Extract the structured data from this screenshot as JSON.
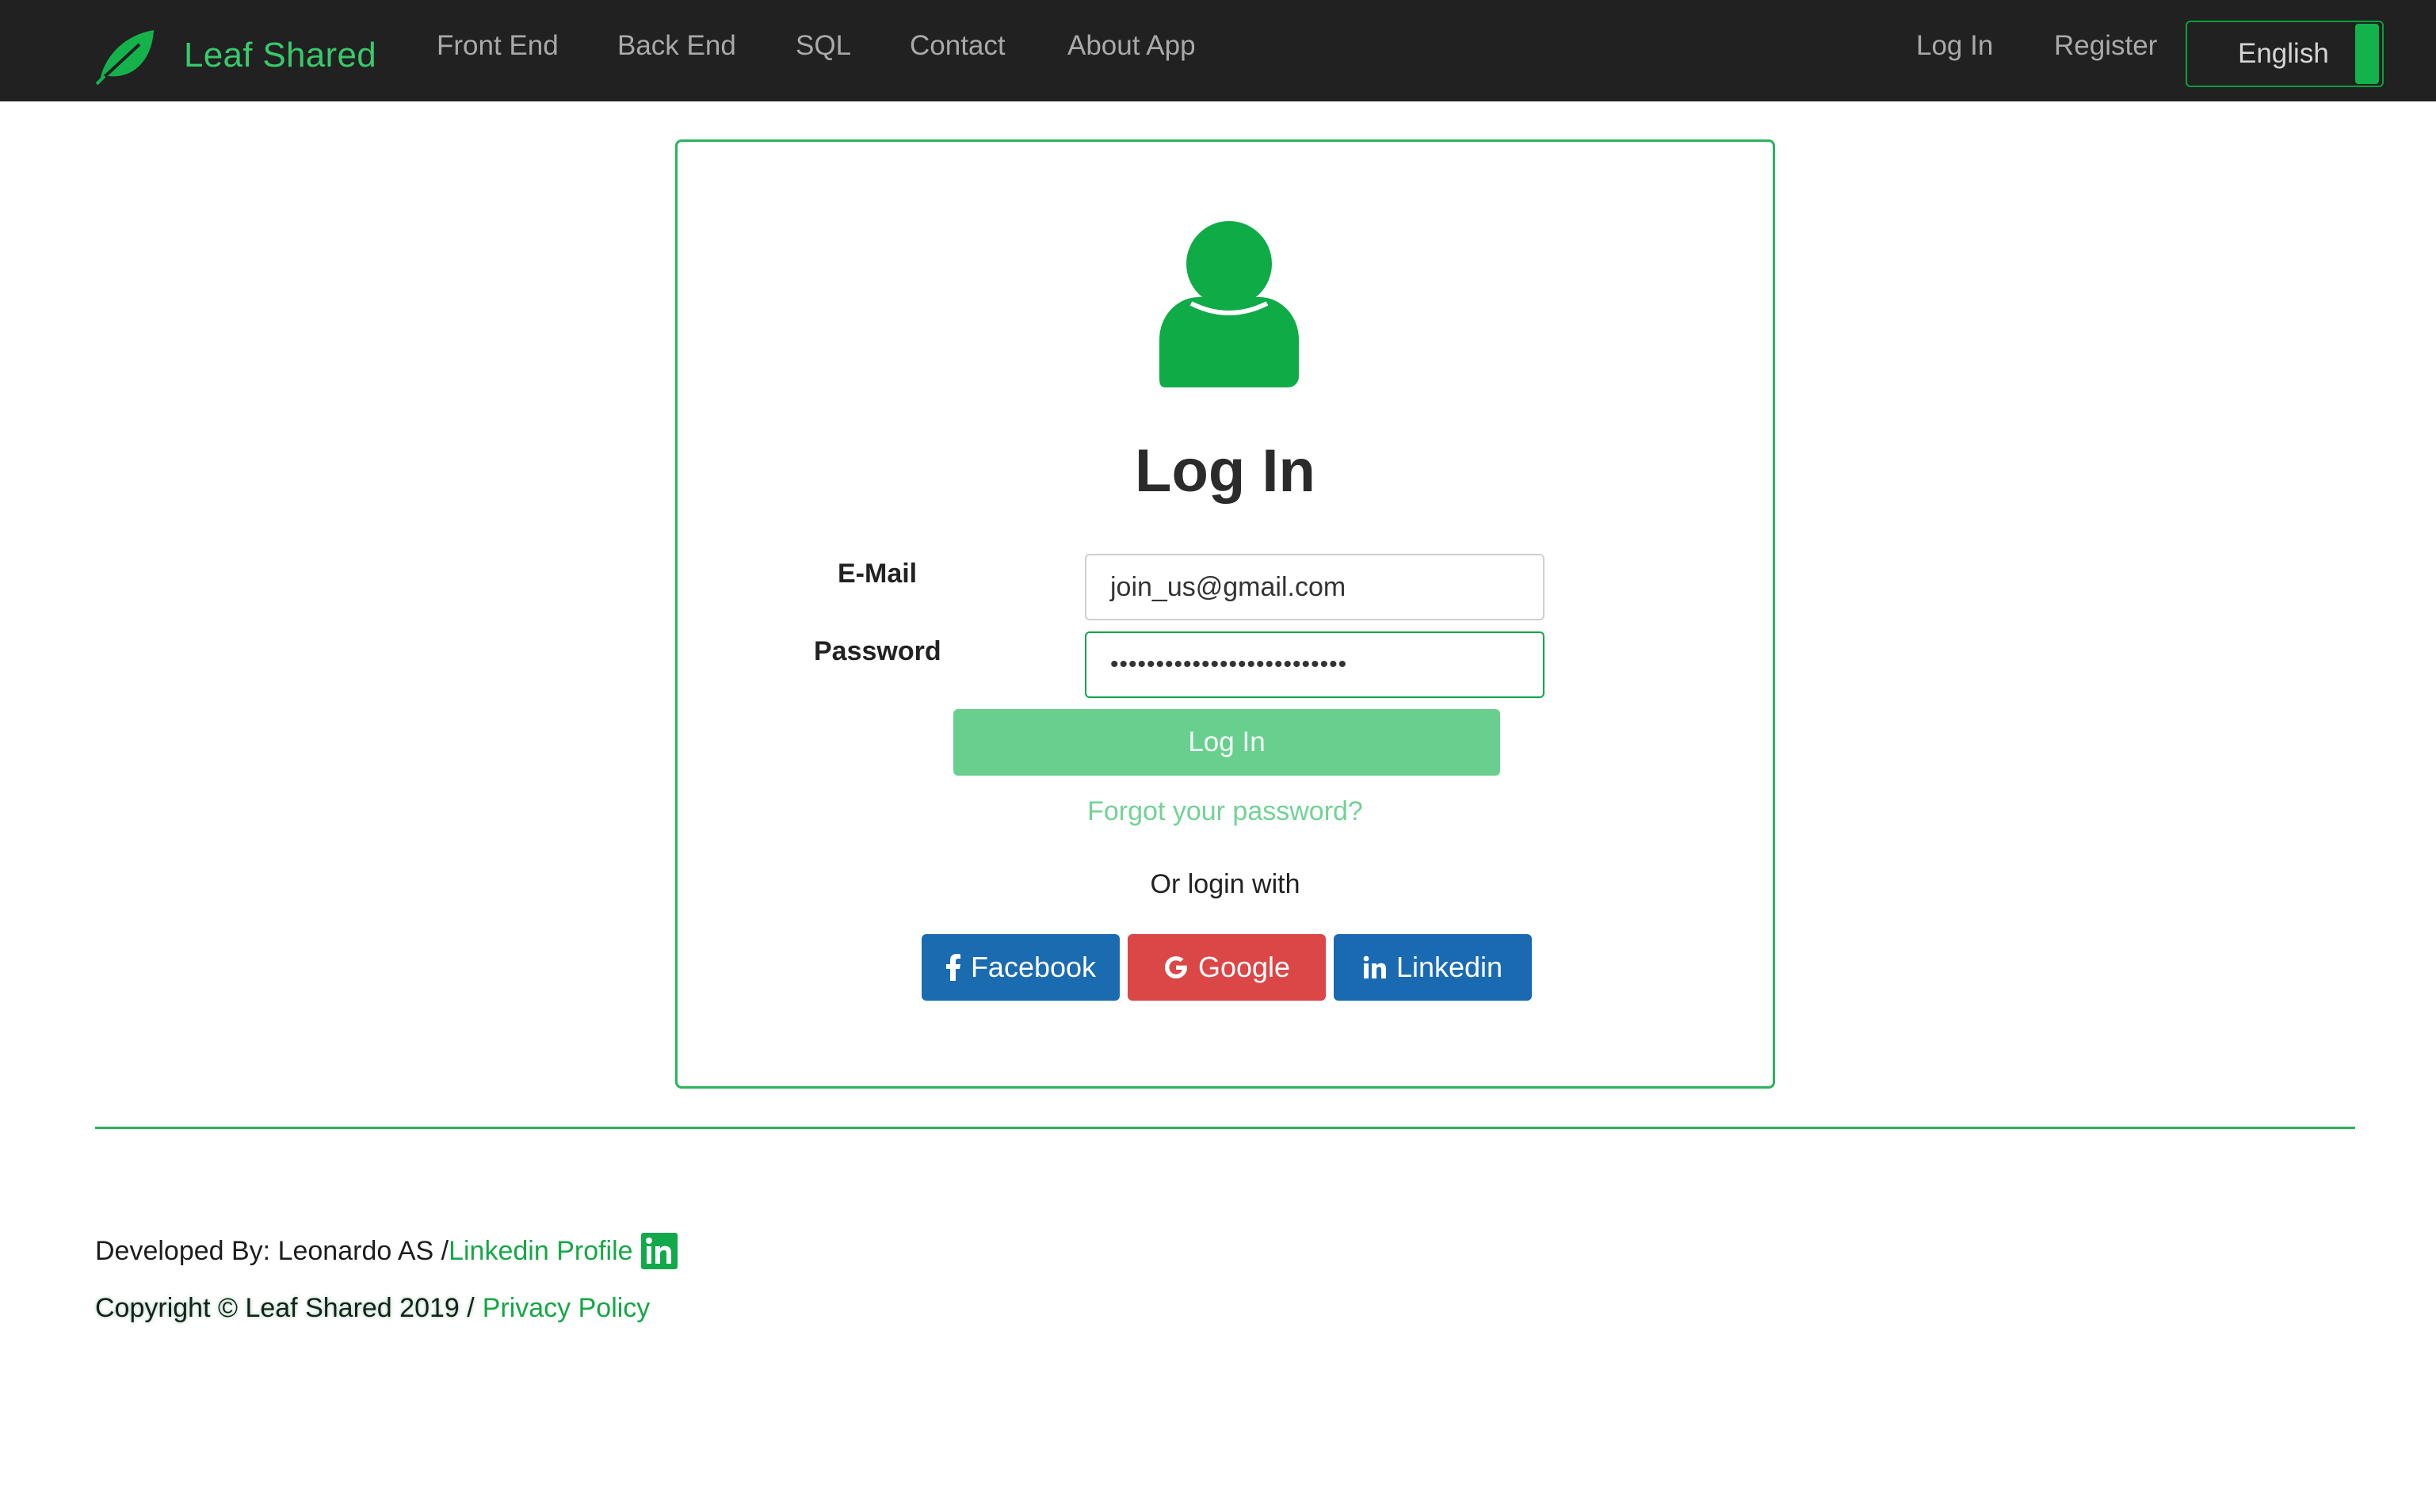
{
  "navbar": {
    "brand": "Leaf Shared",
    "links": [
      "Front End",
      "Back End",
      "SQL",
      "Contact",
      "About App"
    ],
    "login": "Log In",
    "register": "Register",
    "language": "English"
  },
  "login_card": {
    "title": "Log In",
    "email_label": "E-Mail",
    "email_value": "join_us@gmail.com",
    "password_label": "Password",
    "password_value": "••••••••••••••••••••••••••",
    "submit": "Log In",
    "forgot": "Forgot your password?",
    "or_login_with": "Or login with",
    "social": {
      "facebook": "Facebook",
      "google": "Google",
      "linkedin": "Linkedin"
    }
  },
  "footer": {
    "developed_by": "Developed By: Leonardo AS / ",
    "linkedin_profile": "Linkedin Profile",
    "copyright": "Copyright © Leaf Shared 2019 / ",
    "privacy": "Privacy Policy"
  },
  "colors": {
    "accent": "#11b34a",
    "navbar_bg": "#212121",
    "facebook": "#1b6bb0",
    "google": "#db4646",
    "linkedin": "#1a6ab2"
  }
}
